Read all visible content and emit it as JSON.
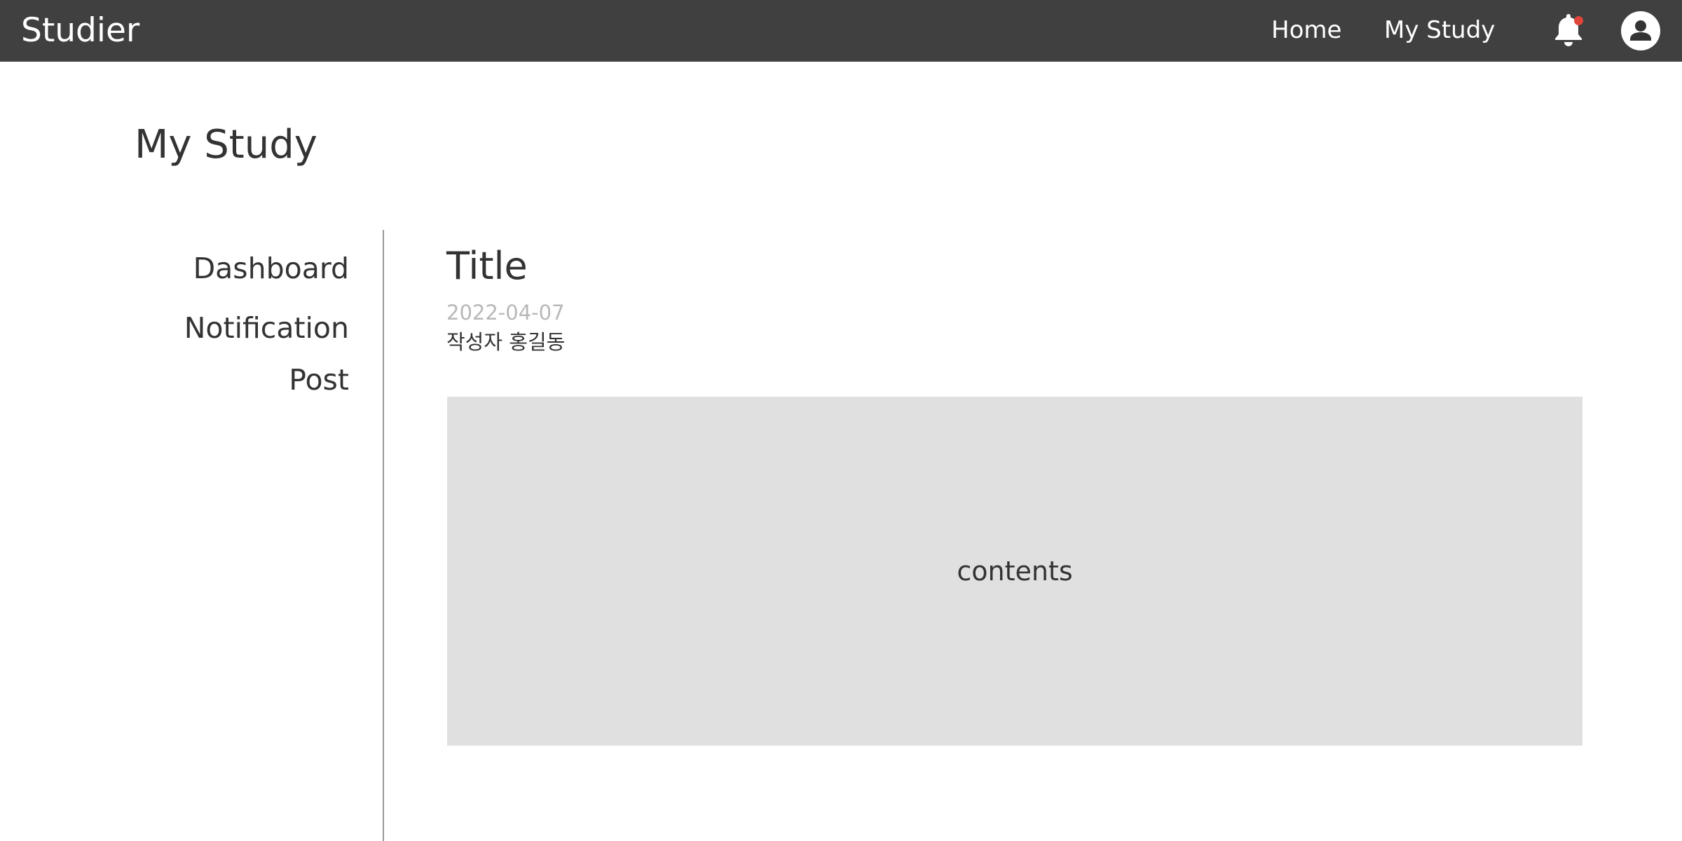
{
  "navbar": {
    "brand": "Studier",
    "links": [
      "Home",
      "My Study"
    ],
    "notification_icon": "bell-icon",
    "notification_dot_color": "#e0453a",
    "profile_icon": "user-avatar-icon"
  },
  "page": {
    "title": "My Study"
  },
  "sidebar": {
    "items": [
      "Dashboard",
      "Notification",
      "Post"
    ]
  },
  "post": {
    "title": "Title",
    "date": "2022-04-07",
    "author": "작성자 홍길동",
    "content": "contents"
  },
  "colors": {
    "navbar_background": "#404040",
    "content_background": "#e0e0e0",
    "date_text": "#b8b8b8"
  }
}
